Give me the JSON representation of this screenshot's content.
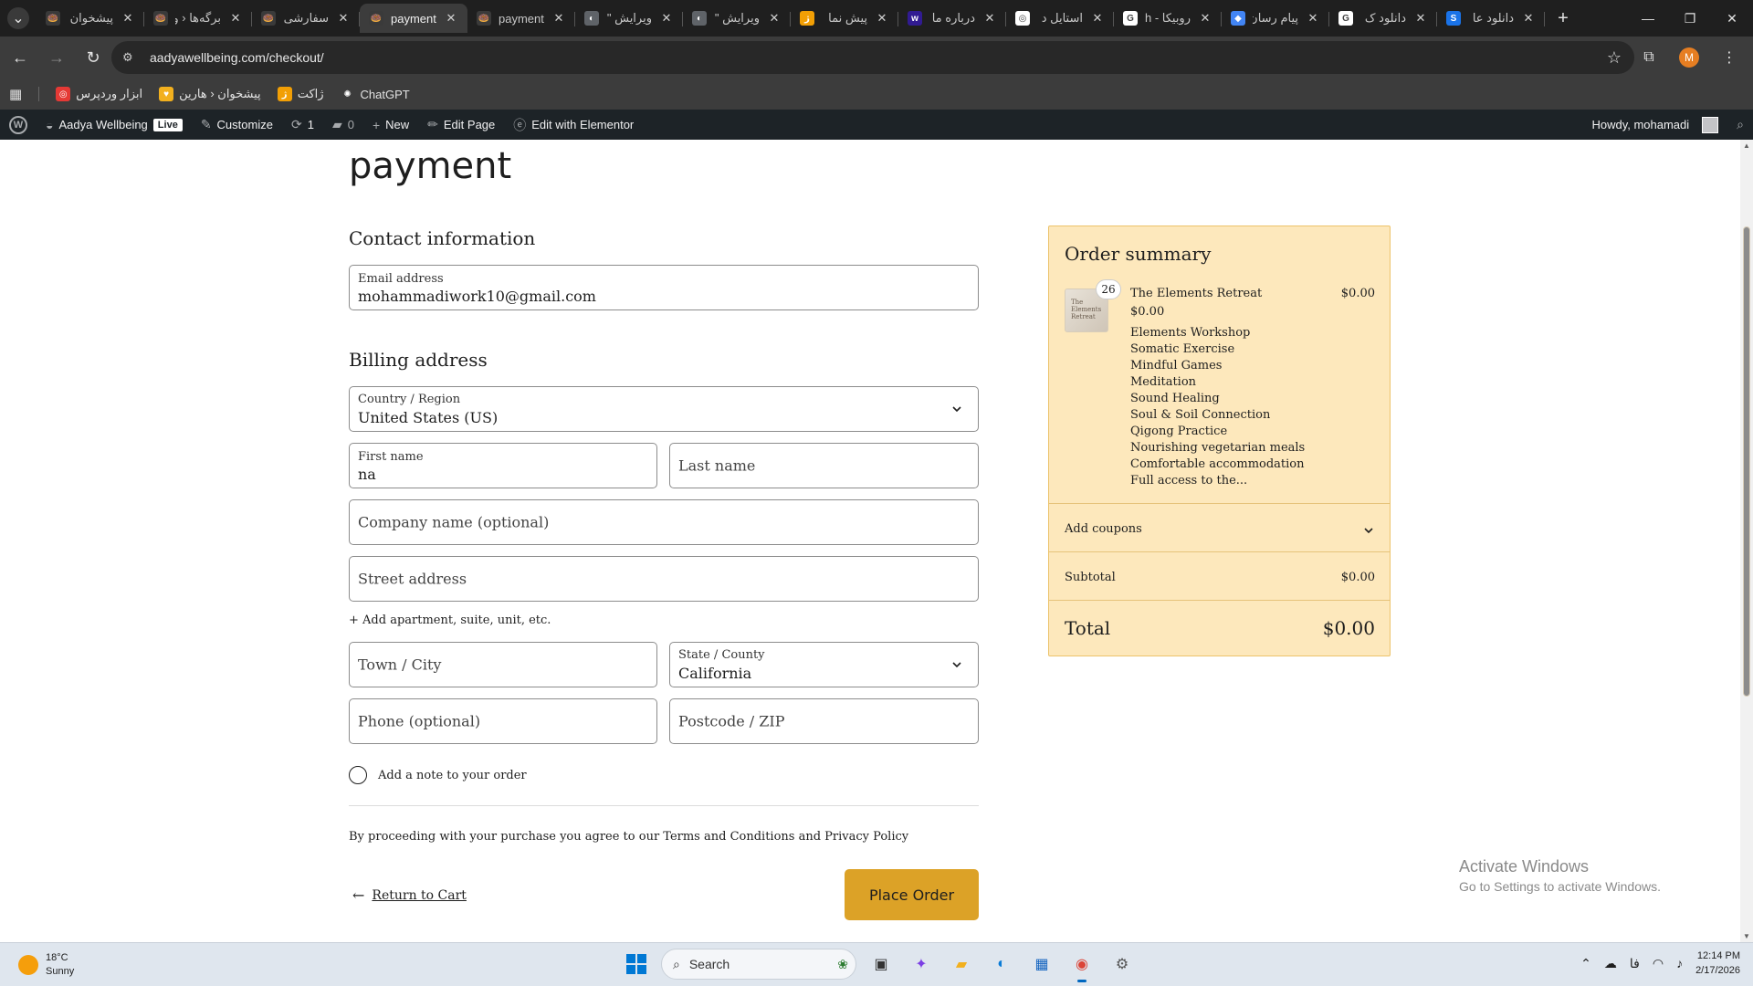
{
  "browser": {
    "tabs": [
      {
        "title": "پیشخوان",
        "fav_color": "#3a3a3a",
        "fav_glyph": "🍩",
        "active": false,
        "rtl": true
      },
      {
        "title": "برگه‌ها ‹ و",
        "fav_color": "#3a3a3a",
        "fav_glyph": "🍩",
        "active": false,
        "rtl": true
      },
      {
        "title": "سفارشی‌",
        "fav_color": "#3a3a3a",
        "fav_glyph": "🍩",
        "active": false,
        "rtl": true
      },
      {
        "title": "payment",
        "fav_color": "#3a3a3a",
        "fav_glyph": "🍩",
        "active": true,
        "rtl": false
      },
      {
        "title": "payment",
        "fav_color": "#3a3a3a",
        "fav_glyph": "🍩",
        "active": false,
        "rtl": false
      },
      {
        "title": "ویرایش \"",
        "fav_color": "#5f6368",
        "fav_glyph": "◐",
        "active": false,
        "rtl": true
      },
      {
        "title": "ویرایش \"",
        "fav_color": "#5f6368",
        "fav_glyph": "◐",
        "active": false,
        "rtl": true
      },
      {
        "title": "پیش نما",
        "fav_color": "#f29f05",
        "fav_glyph": "ژ",
        "active": false,
        "rtl": true
      },
      {
        "title": "درباره ما",
        "fav_color": "#311b92",
        "fav_glyph": "w",
        "active": false,
        "rtl": true
      },
      {
        "title": "استایل د",
        "fav_color": "#ffffff",
        "fav_glyph": "◎",
        "active": false,
        "rtl": true
      },
      {
        "title": "روبیکا - h",
        "fav_color": "#ffffff",
        "fav_glyph": "G",
        "active": false,
        "rtl": true
      },
      {
        "title": "پیام رسان",
        "fav_color": "#4285f4",
        "fav_glyph": "◆",
        "active": false,
        "rtl": true
      },
      {
        "title": "دانلود ک",
        "fav_color": "#ffffff",
        "fav_glyph": "G",
        "active": false,
        "rtl": true
      },
      {
        "title": "دانلود عا",
        "fav_color": "#1a73e8",
        "fav_glyph": "S",
        "active": false,
        "rtl": true
      }
    ],
    "url": "aadyawellbeing.com/checkout/",
    "profile_initial": "M",
    "bookmarks": [
      {
        "label": "ابزار وردپرس",
        "fav_color": "#e53935",
        "fav_glyph": "◎"
      },
      {
        "label": "پیشخوان ‹ هارین",
        "fav_color": "#f2b01e",
        "fav_glyph": "♥"
      },
      {
        "label": "ژاکت",
        "fav_color": "#f29f05",
        "fav_glyph": "ژ"
      },
      {
        "label": "ChatGPT",
        "fav_color": "#3c3c3c",
        "fav_glyph": "✺"
      }
    ]
  },
  "wp_admin": {
    "site_name": "Aadya Wellbeing",
    "live_badge": "Live",
    "customize": "Customize",
    "updates_count": "1",
    "comments_count": "0",
    "new_label": "New",
    "edit_page": "Edit Page",
    "edit_elementor": "Edit with Elementor",
    "howdy": "Howdy, mohamadi"
  },
  "checkout": {
    "page_title": "payment",
    "contact_heading": "Contact information",
    "email_label": "Email address",
    "email_value": "mohammadiwork10@gmail.com",
    "billing_heading": "Billing address",
    "country_label": "Country / Region",
    "country_value": "United States (US)",
    "first_name_label": "First name",
    "first_name_value": "na",
    "last_name_placeholder": "Last name",
    "company_placeholder": "Company name (optional)",
    "street_placeholder": "Street address",
    "add_apartment": "+ Add apartment, suite, unit, etc.",
    "city_placeholder": "Town / City",
    "state_label": "State / County",
    "state_value": "California",
    "phone_placeholder": "Phone (optional)",
    "postcode_placeholder": "Postcode / ZIP",
    "note_label": "Add a note to your order",
    "terms_text": "By proceeding with your purchase you agree to our Terms and Conditions and Privacy Policy",
    "return_label": "Return to Cart",
    "place_order_label": "Place Order",
    "accent_color": "#dca227"
  },
  "summary": {
    "heading": "Order summary",
    "quantity": "26",
    "item_name": "The Elements Retreat",
    "item_price": "$0.00",
    "item_unit_price": "$0.00",
    "thumb_text": "The Elements Retreat",
    "features": [
      "Elements Workshop",
      "Somatic Exercise",
      "Mindful Games",
      "Meditation",
      "Sound Healing",
      "Soul & Soil Connection",
      "Qigong Practice",
      "Nourishing vegetarian meals",
      "Comfortable accommodation",
      "Full access to the..."
    ],
    "coupons_label": "Add coupons",
    "subtotal_label": "Subtotal",
    "subtotal_value": "$0.00",
    "total_label": "Total",
    "total_value": "$0.00",
    "background_color": "#fde8bc"
  },
  "watermark": {
    "line1": "Activate Windows",
    "line2": "Go to Settings to activate Windows."
  },
  "taskbar": {
    "temperature": "18°C",
    "condition": "Sunny",
    "search_placeholder": "Search",
    "language": "فا",
    "time": "12:14 PM",
    "date": "2/17/2026"
  }
}
